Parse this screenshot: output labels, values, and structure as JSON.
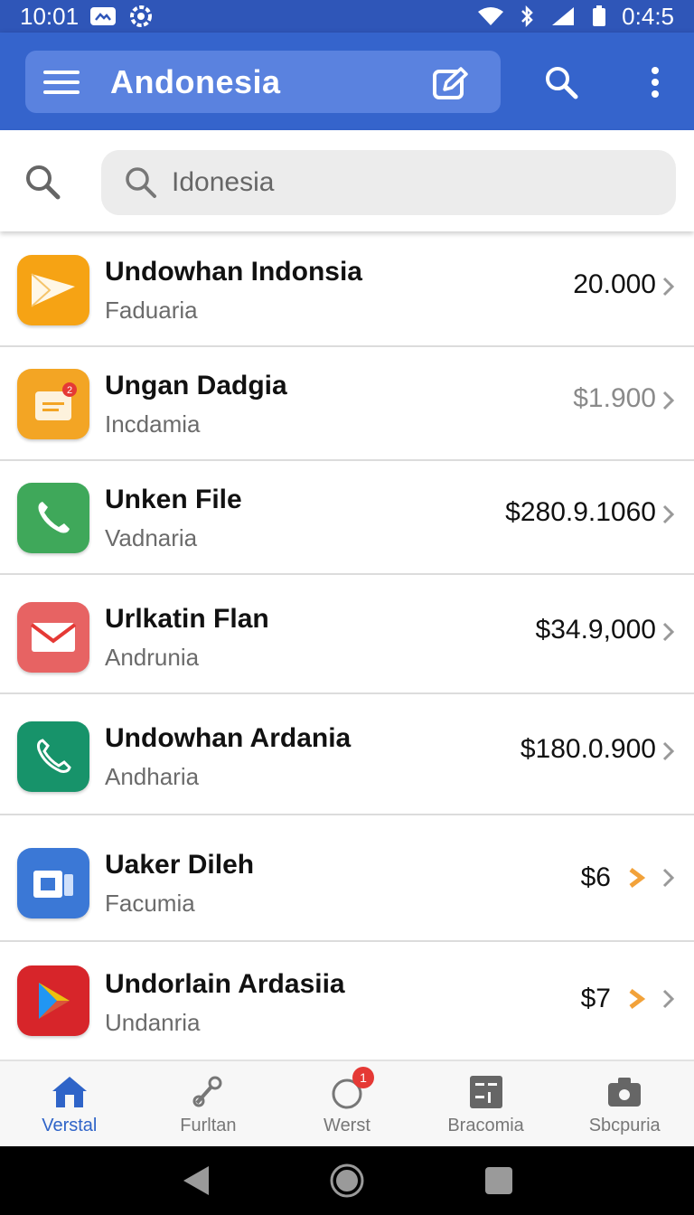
{
  "status_bar": {
    "time_left": "10:01",
    "time_right": "0:4:5"
  },
  "app_bar": {
    "title": "Andonesia"
  },
  "search": {
    "placeholder": "Idonesia"
  },
  "items": [
    {
      "title": "Undowhan Indonsia",
      "subtitle": "Faduaria",
      "price": "20.000",
      "icon": "mail-send-icon",
      "color": "#f6a314"
    },
    {
      "title": "Ungan Dadgia",
      "subtitle": "Incdamia",
      "price": "$1.900",
      "icon": "file-folder-icon",
      "color": "#f3a524",
      "badge": "2"
    },
    {
      "title": "Unken File",
      "subtitle": "Vadnaria",
      "price": "$280.9.1060",
      "icon": "phone-icon",
      "color": "#3fa85a"
    },
    {
      "title": "Urlkatin Flan",
      "subtitle": "Andrunia",
      "price": "$34.9,000",
      "icon": "gmail-icon",
      "color": "#e76363"
    },
    {
      "title": "Undowhan Ardania",
      "subtitle": "Andharia",
      "price": "$180.0.900",
      "icon": "phone-icon",
      "color": "#17936a"
    },
    {
      "title": "Uaker Dileh",
      "subtitle": "Facumia",
      "price": "$6",
      "icon": "files-icon",
      "color": "#3b78d6"
    },
    {
      "title": "Undorlain Ardasiia",
      "subtitle": "Undanria",
      "price": "$7",
      "icon": "play-store-icon",
      "color": "#d7252a"
    }
  ],
  "bottom_nav": [
    {
      "label": "Verstal",
      "icon": "home-icon",
      "active": true
    },
    {
      "label": "Furltan",
      "icon": "tools-icon"
    },
    {
      "label": "Werst",
      "icon": "circle-icon",
      "badge": "1"
    },
    {
      "label": "Bracomia",
      "icon": "calculator-icon"
    },
    {
      "label": "Sbcpuria",
      "icon": "camera-icon"
    }
  ],
  "colors": {
    "primary": "#3564cc",
    "status_bar": "#2f56b8",
    "accent_orange": "#f2a23a",
    "active_tab": "#2f64c8"
  }
}
